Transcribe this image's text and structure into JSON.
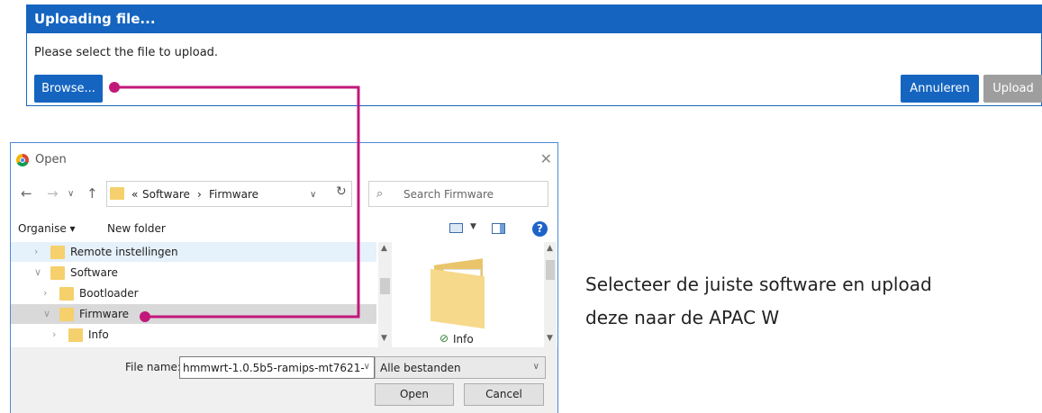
{
  "upload_dialog": {
    "title": "Uploading file...",
    "message": "Please select the file to upload.",
    "browse_label": "Browse...",
    "cancel_label": "Annuleren",
    "upload_label": "Upload"
  },
  "open_dialog": {
    "title": "Open",
    "close_label": "✕",
    "nav": {
      "back": "←",
      "forward": "→",
      "recent": "∨",
      "up": "↑"
    },
    "address": {
      "prefix": "«",
      "crumbs": [
        "Software",
        "Firmware"
      ],
      "separator": "›",
      "dropdown": "∨",
      "refresh": "↻"
    },
    "search_placeholder": "Search Firmware",
    "toolbar": {
      "organise": "Organise ▾",
      "new_folder": "New folder",
      "help": "?"
    },
    "tree": [
      {
        "label": "Remote instellingen",
        "chevron": "›"
      },
      {
        "label": "Software",
        "chevron": "∨"
      },
      {
        "label": "Bootloader",
        "chevron": "›"
      },
      {
        "label": "Firmware",
        "chevron": "∨"
      },
      {
        "label": "Info",
        "chevron": "›"
      }
    ],
    "preview": {
      "item_label": "Info",
      "check": "⊘"
    },
    "file_name_label": "File name:",
    "file_name_value": "hmmwrt-1.0.5b5-ramips-mt7621-",
    "filter_value": "Alle bestanden",
    "open_label": "Open",
    "cancel_label": "Cancel"
  },
  "caption": {
    "line1": "Selecteer de juiste software en upload",
    "line2": "deze naar de APAC W"
  },
  "colors": {
    "header_blue": "#1565c0",
    "disabled_gray": "#9e9e9e",
    "connector_magenta": "#c2187a",
    "folder_yellow": "#f5d06c"
  }
}
